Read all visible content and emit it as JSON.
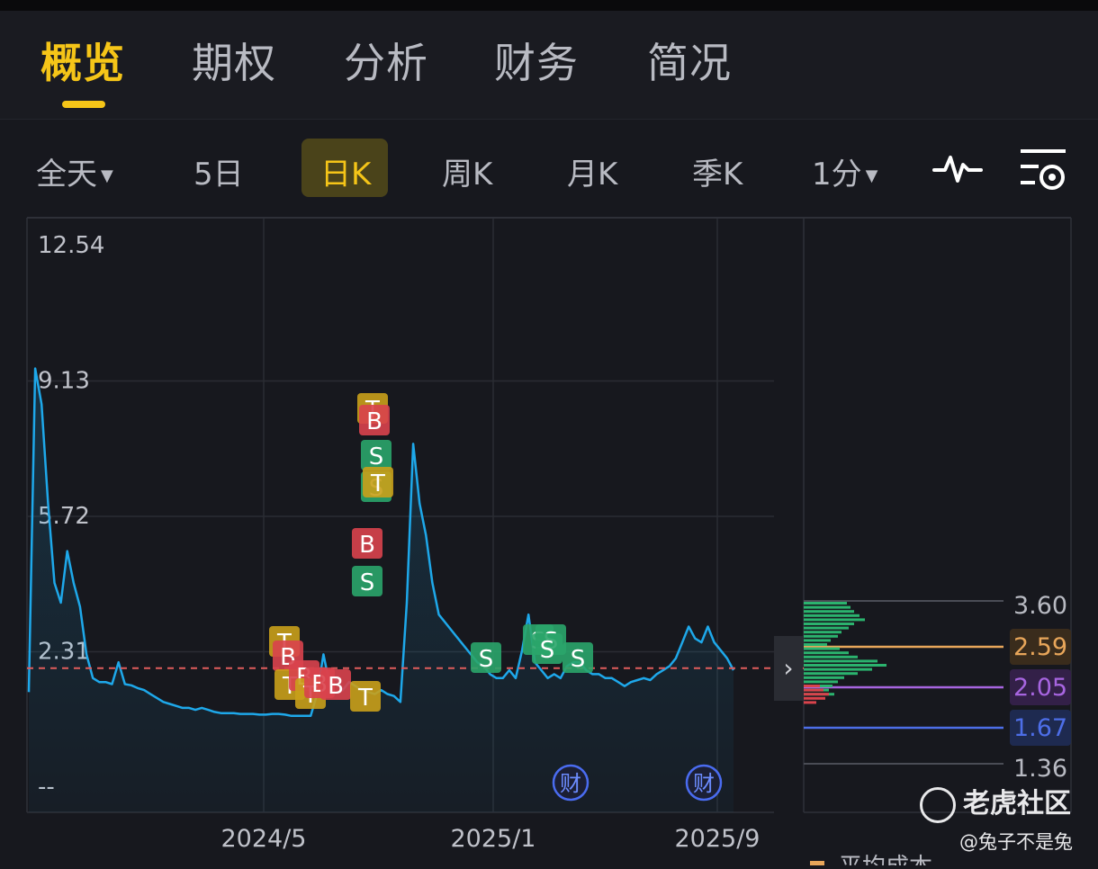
{
  "tabs": [
    {
      "label": "概览",
      "active": true
    },
    {
      "label": "期权",
      "active": false
    },
    {
      "label": "分析",
      "active": false
    },
    {
      "label": "财务",
      "active": false
    },
    {
      "label": "简况",
      "active": false
    }
  ],
  "periods": [
    {
      "label": "全天",
      "dropdown": true
    },
    {
      "label": "5日"
    },
    {
      "label": "日K",
      "active": true
    },
    {
      "label": "周K"
    },
    {
      "label": "月K"
    },
    {
      "label": "季K"
    },
    {
      "label": "1分",
      "dropdown": true
    }
  ],
  "icons": {
    "indicator": "waveform-icon",
    "settings": "settings-filter-icon",
    "expand": "chevron-right-icon",
    "watermark": "tiger-logo-icon"
  },
  "chart_data": {
    "type": "line",
    "y_ticks": [
      "12.54",
      "9.13",
      "5.72",
      "2.31",
      "--"
    ],
    "x_ticks": [
      "2024/5",
      "2025/1",
      "2025/9"
    ],
    "yrange": [
      -1.1,
      12.54
    ],
    "reference_line": 1.85,
    "series": [
      {
        "values": [
          1.25,
          9.4,
          8.5,
          6.0,
          4.0,
          3.5,
          4.8,
          4.0,
          3.4,
          2.2,
          1.6,
          1.5,
          1.5,
          1.45,
          2.0,
          1.45,
          1.42,
          1.35,
          1.3,
          1.2,
          1.1,
          1.0,
          0.95,
          0.9,
          0.85,
          0.85,
          0.8,
          0.85,
          0.8,
          0.75,
          0.72,
          0.72,
          0.72,
          0.7,
          0.7,
          0.7,
          0.68,
          0.68,
          0.7,
          0.7,
          0.68,
          0.65,
          0.65,
          0.65,
          0.65,
          1.2,
          2.2,
          1.4,
          1.6,
          1.3,
          1.5,
          1.4,
          1.3,
          1.25,
          1.2,
          1.3,
          1.2,
          1.15,
          1.0,
          3.5,
          7.5,
          6.0,
          5.2,
          4.0,
          3.2,
          3.0,
          2.8,
          2.6,
          2.4,
          2.2,
          2.0,
          1.9,
          1.7,
          1.6,
          1.6,
          1.8,
          1.6,
          2.3,
          3.2,
          2.0,
          1.8,
          1.6,
          1.7,
          1.6,
          1.9,
          2.0,
          2.0,
          1.8,
          1.7,
          1.7,
          1.6,
          1.6,
          1.5,
          1.4,
          1.5,
          1.55,
          1.6,
          1.55,
          1.7,
          1.8,
          1.9,
          2.1,
          2.5,
          2.9,
          2.6,
          2.5,
          2.9,
          2.5,
          2.3,
          2.1,
          1.8
        ]
      }
    ],
    "trade_markers": [
      "T",
      "B",
      "T",
      "B",
      "T",
      "B",
      "B",
      "S",
      "S",
      "B",
      "S",
      "T",
      "T",
      "S",
      "T",
      "B",
      "S",
      "S",
      "S",
      "S"
    ],
    "event_markers": [
      "财",
      "财"
    ],
    "price_distribution": {
      "levels": [
        "3.60",
        "2.59",
        "2.05",
        "1.67",
        "1.36"
      ],
      "legend": "平均成本"
    }
  },
  "watermark": {
    "brand": "老虎社区",
    "handle": "@兔子不是兔"
  }
}
